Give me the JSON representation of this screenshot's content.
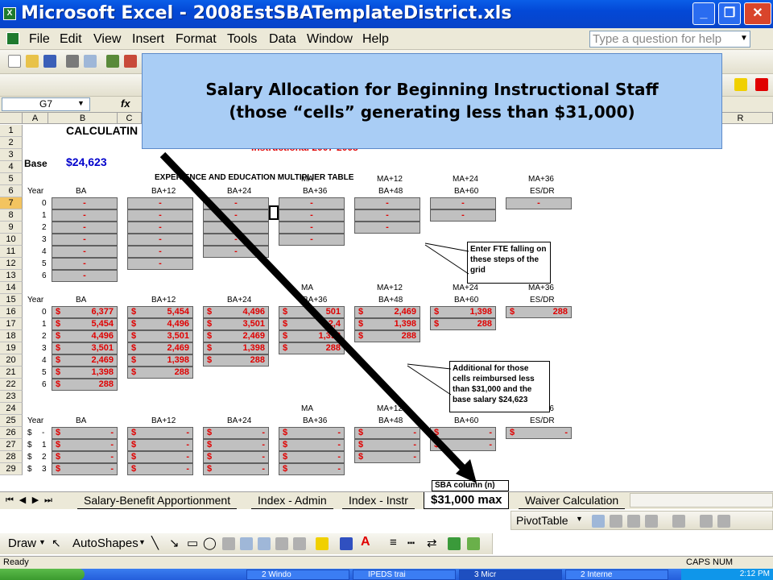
{
  "window": {
    "title": "Microsoft Excel - 2008EstSBATemplateDistrict.xls"
  },
  "menu": {
    "items": [
      "File",
      "Edit",
      "View",
      "Insert",
      "Format",
      "Tools",
      "Data",
      "Window",
      "Help"
    ],
    "help_placeholder": "Type a question for help"
  },
  "formula_bar": {
    "name_box": "G7",
    "fx": "fx"
  },
  "columns": [
    "A",
    "B",
    "C",
    "R"
  ],
  "rows": [
    "1",
    "2",
    "3",
    "4",
    "5",
    "6",
    "7",
    "8",
    "9",
    "10",
    "11",
    "12",
    "13",
    "14",
    "15",
    "16",
    "17",
    "18",
    "19",
    "20",
    "21",
    "22",
    "23",
    "24",
    "25",
    "26",
    "27",
    "28",
    "29"
  ],
  "sheet": {
    "title_partial": "CALCULATIN",
    "subtitle_partial": "Instructional 2007-2008",
    "base_label": "Base",
    "base_value": "$24,623",
    "table_title": "EXPERIENCE AND EDUCATION MULTIPLIER TABLE",
    "top_headers": [
      "MA",
      "MA+12",
      "MA+24",
      "MA+36"
    ],
    "headers": [
      "BA",
      "BA+12",
      "BA+24",
      "BA+36",
      "BA+48",
      "BA+60",
      "ES/DR"
    ],
    "year_label": "Year",
    "steps": [
      "0",
      "1",
      "2",
      "3",
      "4",
      "5",
      "6"
    ],
    "dollar_steps": [
      "$",
      "$",
      "$",
      "$"
    ],
    "dollar_step_nums": [
      "-",
      "1",
      "2",
      "3"
    ],
    "dash": "-",
    "currency": "$",
    "block2": {
      "BA": [
        "6,377",
        "5,454",
        "4,496",
        "3,501",
        "2,469",
        "1,398",
        "288"
      ],
      "BA+12": [
        "5,454",
        "4,496",
        "3,501",
        "2,469",
        "1,398",
        "288"
      ],
      "BA+24": [
        "4,496",
        "3,501",
        "2,469",
        "1,398",
        "288"
      ],
      "BA+36": [
        "501",
        "2,4",
        "1,398",
        "288"
      ],
      "BA+48": [
        "2,469",
        "1,398",
        "288"
      ],
      "BA+60": [
        "1,398",
        "288"
      ],
      "ES/DR": [
        "288"
      ]
    },
    "note1": "Enter FTE falling on these steps of the grid",
    "note2": "Additional for those cells reimbursed less than $31,000 and the base salary $24,623",
    "note3": "SBA column (n)"
  },
  "overlay": {
    "line1": "Salary Allocation for Beginning Instructional Staff",
    "line2": "(those “cells” generating less than $31,000)"
  },
  "tabs": [
    "Salary-Benefit Apportionment",
    "Index - Admin",
    "Index - Instr",
    "$31,000 max",
    "Waiver Calculation"
  ],
  "toolbars": {
    "pivot": "PivotTable",
    "draw": "Draw",
    "autoshapes": "AutoShapes"
  },
  "status": {
    "left": "Ready",
    "right": "CAPS NUM"
  },
  "taskbar": {
    "items": [
      "2 Windo",
      "IPEDS trai",
      "3 Micr",
      "2 Interne"
    ],
    "time": "2:12 PM"
  }
}
